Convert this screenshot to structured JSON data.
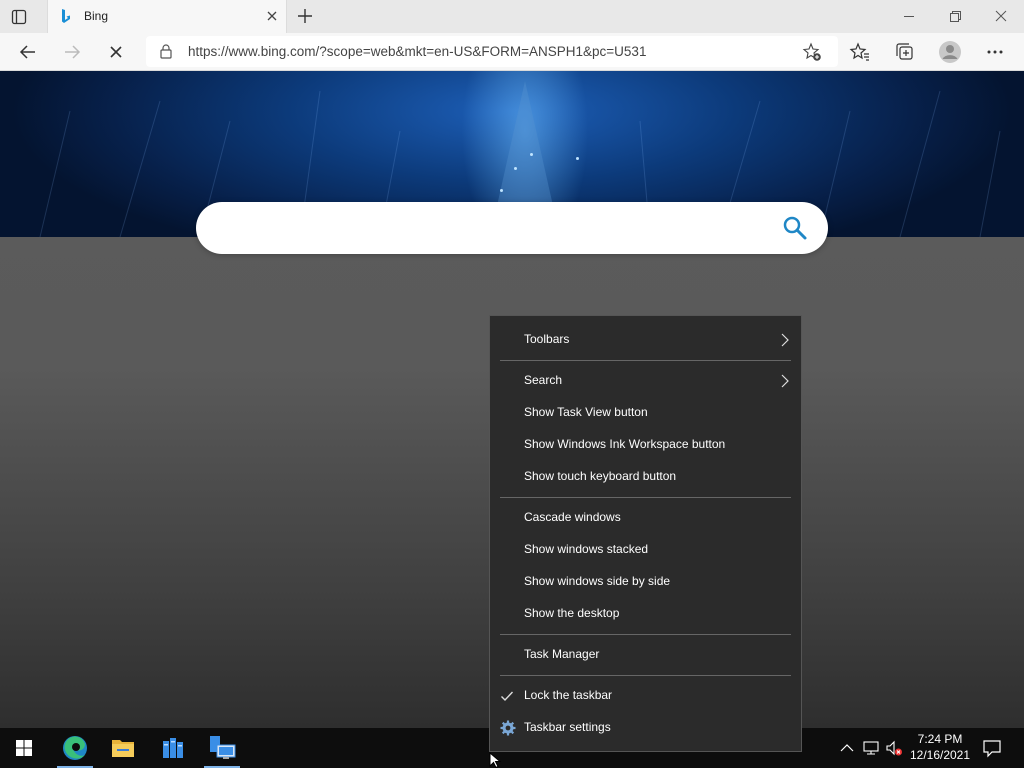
{
  "browser": {
    "tab_title": "Bing",
    "url": "https://www.bing.com/?scope=web&mkt=en-US&FORM=ANSPH1&pc=U531"
  },
  "search": {
    "placeholder": ""
  },
  "context_menu": {
    "groups": [
      [
        {
          "label": "Toolbars",
          "submenu": true
        }
      ],
      [
        {
          "label": "Search",
          "submenu": true
        },
        {
          "label": "Show Task View button"
        },
        {
          "label": "Show Windows Ink Workspace button"
        },
        {
          "label": "Show touch keyboard button"
        }
      ],
      [
        {
          "label": "Cascade windows"
        },
        {
          "label": "Show windows stacked"
        },
        {
          "label": "Show windows side by side"
        },
        {
          "label": "Show the desktop"
        }
      ],
      [
        {
          "label": "Task Manager"
        }
      ],
      [
        {
          "label": "Lock the taskbar",
          "checked": true
        },
        {
          "label": "Taskbar settings",
          "icon": "gear-icon"
        }
      ]
    ]
  },
  "taskbar": {
    "apps": [
      {
        "name": "windows-start-icon"
      },
      {
        "name": "edge-icon",
        "active": true
      },
      {
        "name": "file-explorer-icon"
      },
      {
        "name": "server-manager-icon"
      },
      {
        "name": "remote-desktop-icon",
        "active": true
      }
    ],
    "time": "7:24 PM",
    "date": "12/16/2021"
  },
  "colors": {
    "accent": "#1f87c6",
    "menu_bg": "#2b2b2b",
    "taskbar_bg": "#0d0d0d"
  }
}
